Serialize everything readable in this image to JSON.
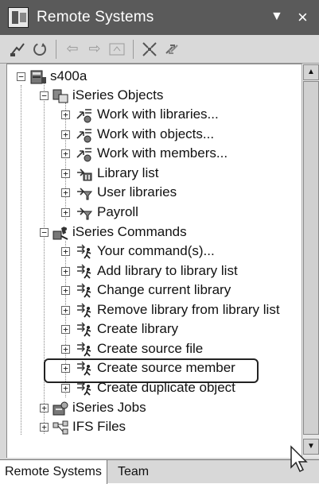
{
  "window": {
    "title": "Remote Systems",
    "menu_icon": "dropdown-triangle-icon",
    "close_icon": "close-icon"
  },
  "toolbar": {
    "buttons": [
      {
        "name": "new-connection-icon",
        "glyph": "⚡",
        "enabled": true
      },
      {
        "name": "refresh-icon",
        "glyph": "⟳",
        "enabled": true
      },
      {
        "name": "back-arrow-icon",
        "glyph": "⇦",
        "enabled": false
      },
      {
        "name": "forward-arrow-icon",
        "glyph": "⇨",
        "enabled": false
      },
      {
        "name": "up-arrow-icon",
        "glyph": "⇧",
        "enabled": false
      },
      {
        "name": "collapse-all-icon",
        "glyph": "⌘",
        "enabled": true
      },
      {
        "name": "link-with-editor-icon",
        "glyph": "⇄",
        "enabled": true
      }
    ]
  },
  "tree": {
    "root": {
      "label": "s400a",
      "icon": "system-connection-icon",
      "expanded": true
    },
    "objects": {
      "label": "iSeries Objects",
      "icon": "iseries-objects-icon",
      "expanded": true,
      "items": [
        {
          "label": "Work with libraries...",
          "icon": "work-with-filter-icon"
        },
        {
          "label": "Work with objects...",
          "icon": "work-with-filter-icon"
        },
        {
          "label": "Work with members...",
          "icon": "work-with-filter-icon"
        },
        {
          "label": "Library list",
          "icon": "library-list-icon"
        },
        {
          "label": "User libraries",
          "icon": "filter-icon"
        },
        {
          "label": "Payroll",
          "icon": "filter-icon"
        }
      ]
    },
    "commands": {
      "label": "iSeries Commands",
      "icon": "iseries-commands-icon",
      "expanded": true,
      "items": [
        {
          "label": "Your command(s)...",
          "icon": "command-icon"
        },
        {
          "label": "Add library to library list",
          "icon": "command-icon"
        },
        {
          "label": "Change current library",
          "icon": "command-icon"
        },
        {
          "label": "Remove library from library list",
          "icon": "command-icon"
        },
        {
          "label": "Create library",
          "icon": "command-icon"
        },
        {
          "label": "Create source file",
          "icon": "command-icon"
        },
        {
          "label": "Create source member",
          "icon": "command-icon",
          "highlighted": true
        },
        {
          "label": "Create duplicate object",
          "icon": "command-icon"
        }
      ]
    },
    "jobs": {
      "label": "iSeries Jobs",
      "icon": "iseries-jobs-icon",
      "expanded": false
    },
    "ifs": {
      "label": "IFS Files",
      "icon": "ifs-files-icon",
      "expanded": false
    }
  },
  "tabs": [
    {
      "label": "Remote Systems",
      "active": true
    },
    {
      "label": "Team",
      "active": false
    }
  ]
}
